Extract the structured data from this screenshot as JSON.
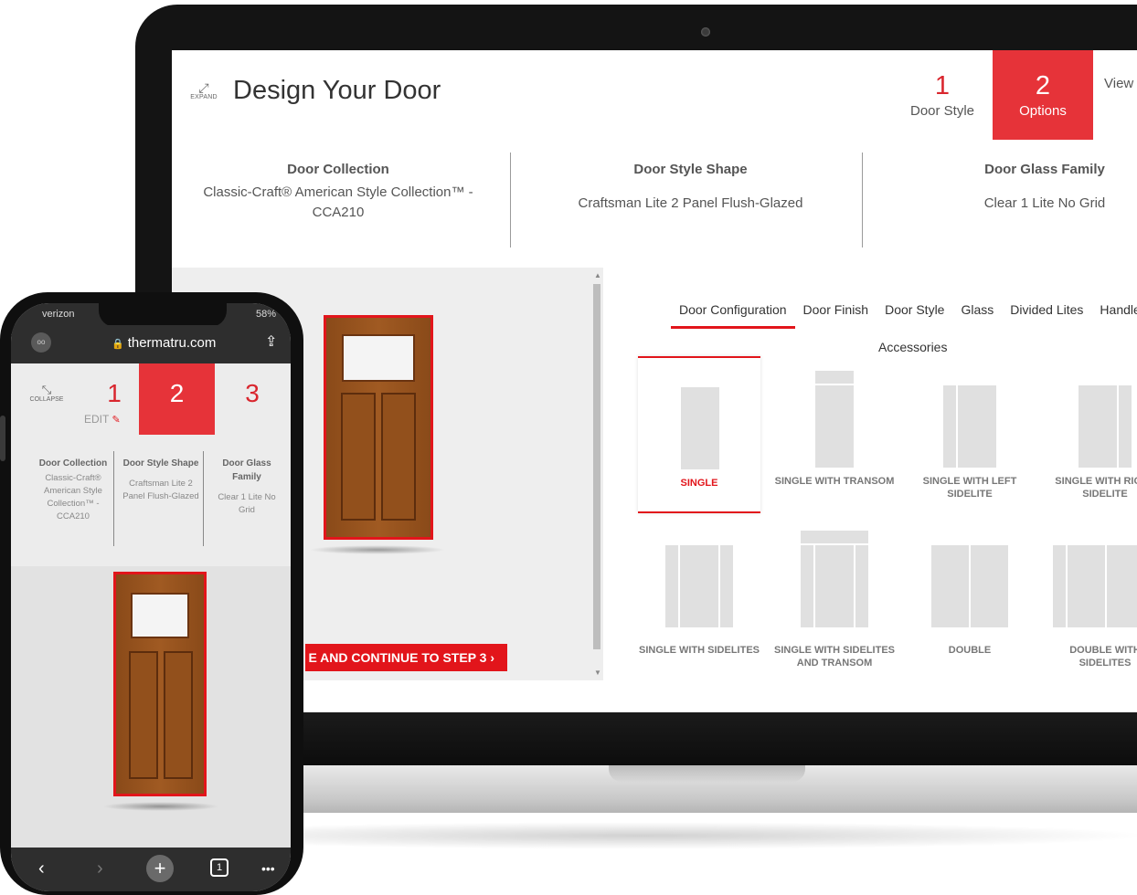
{
  "desktop": {
    "expand_label": "EXPAND",
    "title": "Design Your Door",
    "steps": [
      {
        "num": "1",
        "label": "Door Style"
      },
      {
        "num": "2",
        "label": "Options"
      },
      {
        "num": "",
        "label": "View"
      }
    ],
    "summary": {
      "collection_title": "Door Collection",
      "collection_value": "Classic-Craft® American Style Collection™ - CCA210",
      "shape_title": "Door Style Shape",
      "shape_value": "Craftsman Lite 2 Panel Flush-Glazed",
      "glass_title": "Door Glass Family",
      "glass_value": "Clear 1 Lite No Grid"
    },
    "cta_label": "E AND CONTINUE TO STEP 3 ›",
    "tabs": [
      "Door Configuration",
      "Door Finish",
      "Door Style",
      "Glass",
      "Divided Lites",
      "Handleset"
    ],
    "tab_row2": "Accessories",
    "configs": [
      "SINGLE",
      "SINGLE WITH TRANSOM",
      "SINGLE WITH LEFT SIDELITE",
      "SINGLE WITH RIGHT SIDELITE",
      "SINGLE WITH SIDELITES",
      "SINGLE WITH SIDELITES AND TRANSOM",
      "DOUBLE",
      "DOUBLE WITH SIDELITES"
    ]
  },
  "mobile": {
    "carrier": "verizon",
    "battery": "58%",
    "url": "thermatru.com",
    "collapse_label": "COLLAPSE",
    "steps": [
      "1",
      "2",
      "3"
    ],
    "edit_label": "EDIT",
    "summary": {
      "collection_title": "Door Collection",
      "collection_value": "Classic-Craft® American Style Collection™ - CCA210",
      "shape_title": "Door Style Shape",
      "shape_value": "Craftsman Lite 2 Panel Flush-Glazed",
      "glass_title": "Door Glass Family",
      "glass_value": "Clear 1 Lite No Grid"
    },
    "toolbar": {
      "back": "‹",
      "forward": "›",
      "new_tab": "+",
      "tabs_count": "1",
      "more": "•••"
    }
  },
  "colors": {
    "accent": "#e2151b",
    "step_active": "#e63339",
    "door_wood": "#8a4a19"
  },
  "icons": [
    "expand-icon",
    "collapse-icon",
    "lock-icon",
    "share-icon",
    "pencil-icon",
    "reader-icon",
    "chevron-right-icon"
  ]
}
